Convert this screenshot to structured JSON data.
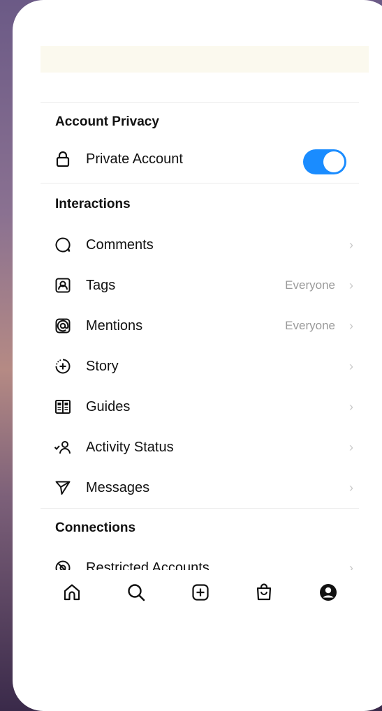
{
  "privacy": {
    "title": "Account Privacy",
    "private_label": "Private Account",
    "private_on": true
  },
  "interactions": {
    "title": "Interactions",
    "items": [
      {
        "label": "Comments",
        "value": "",
        "icon": "comment-icon"
      },
      {
        "label": "Tags",
        "value": "Everyone",
        "icon": "tag-person-icon"
      },
      {
        "label": "Mentions",
        "value": "Everyone",
        "icon": "at-sign-icon"
      },
      {
        "label": "Story",
        "value": "",
        "icon": "story-plus-icon"
      },
      {
        "label": "Guides",
        "value": "",
        "icon": "guides-book-icon"
      },
      {
        "label": "Activity Status",
        "value": "",
        "icon": "activity-status-icon"
      },
      {
        "label": "Messages",
        "value": "",
        "icon": "paper-plane-icon"
      }
    ]
  },
  "connections": {
    "title": "Connections",
    "items": [
      {
        "label": "Restricted Accounts",
        "icon": "restricted-eye-icon"
      }
    ]
  },
  "tabbar": {
    "items": [
      "home-icon",
      "search-icon",
      "create-plus-icon",
      "shop-bag-icon",
      "profile-icon"
    ]
  },
  "colors": {
    "toggle_on": "#1a8cff",
    "accent_bg": "#fbf9ee"
  }
}
